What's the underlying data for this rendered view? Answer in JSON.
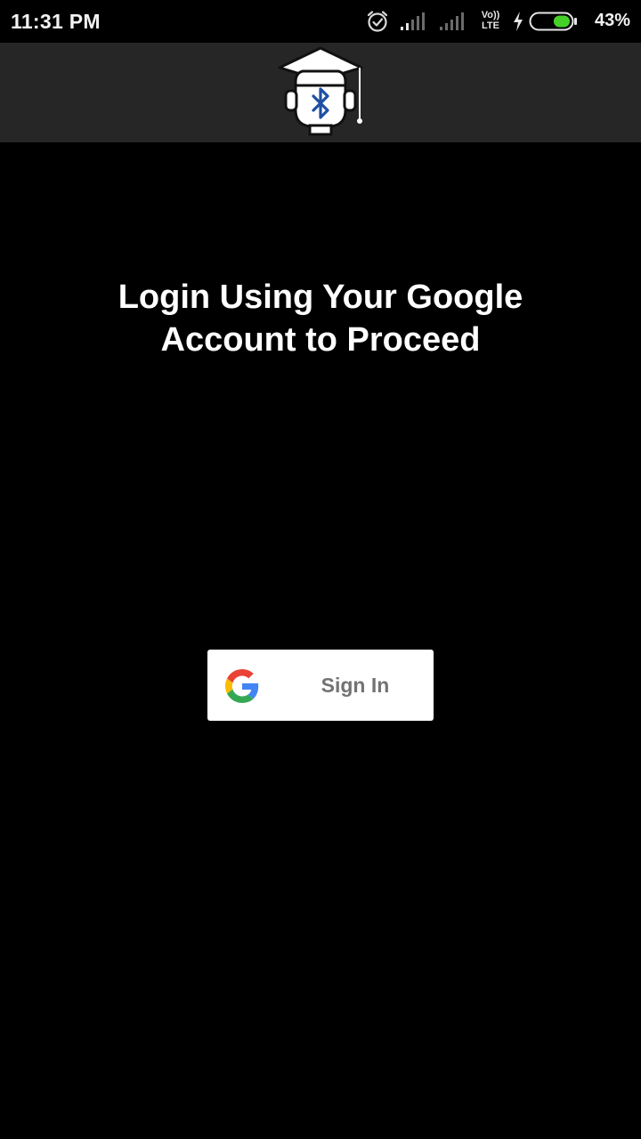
{
  "status_bar": {
    "time": "11:31 PM",
    "battery_percent": "43%",
    "network_label_top": "Vo))",
    "network_label_bottom": "LTE",
    "battery_level": 0.43,
    "icons": [
      "alarm-icon",
      "signal-icon",
      "signal-icon",
      "volte-icon",
      "charging-icon",
      "battery-icon"
    ]
  },
  "app_bar": {
    "logo_icon": "graduation-cap-bluetooth-logo",
    "background": "#262626"
  },
  "main": {
    "heading_line1": "Login Using Your Google",
    "heading_line2": "Account to Proceed"
  },
  "signin": {
    "label": "Sign In",
    "icon": "google-g-icon"
  },
  "colors": {
    "background": "#000000",
    "bluetooth_blue": "#1e4fa3",
    "battery_green": "#46d128",
    "button_text": "#737373"
  }
}
